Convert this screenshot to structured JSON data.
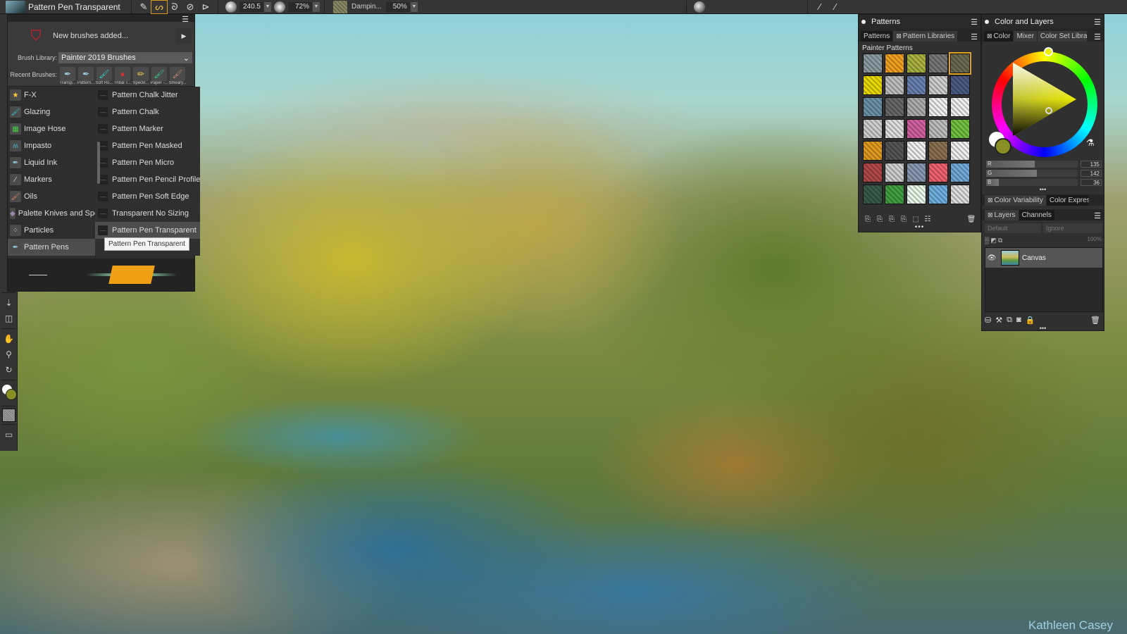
{
  "topbar": {
    "brush_category": "Pattern Pens",
    "brush_name": "Pattern Pen Transparent",
    "size_value": "240.5",
    "opacity_value": "72%",
    "damping_label": "Dampin...",
    "damping_value": "50%"
  },
  "brush_panel": {
    "new_brushes_label": "New brushes added...",
    "library_label": "Brush Library:",
    "library_value": "Painter 2019 Brushes",
    "recent_label": "Recent Brushes:",
    "recent": [
      {
        "label": "Transp..."
      },
      {
        "label": "Pattern..."
      },
      {
        "label": "Soft Ro..."
      },
      {
        "label": "Tribal T..."
      },
      {
        "label": "Speckl..."
      },
      {
        "label": "Paper -..."
      },
      {
        "label": "Smeary..."
      }
    ],
    "categories": [
      {
        "label": "F-X",
        "icon": "star-icon"
      },
      {
        "label": "Glazing",
        "icon": "glazing-brush-icon"
      },
      {
        "label": "Image Hose",
        "icon": "image-hose-icon"
      },
      {
        "label": "Impasto",
        "icon": "impasto-icon"
      },
      {
        "label": "Liquid Ink",
        "icon": "liquid-ink-icon"
      },
      {
        "label": "Markers",
        "icon": "marker-icon"
      },
      {
        "label": "Oils",
        "icon": "oil-brush-icon"
      },
      {
        "label": "Palette Knives and Sponges",
        "icon": "palette-knife-icon"
      },
      {
        "label": "Particles",
        "icon": "particles-icon"
      },
      {
        "label": "Pattern Pens",
        "icon": "pattern-pen-icon",
        "selected": true
      }
    ],
    "variants": [
      {
        "label": "Pattern Chalk Jitter"
      },
      {
        "label": "Pattern Chalk"
      },
      {
        "label": "Pattern Marker"
      },
      {
        "label": "Pattern Pen Masked"
      },
      {
        "label": "Pattern Pen Micro"
      },
      {
        "label": "Pattern Pen Pencil Profile"
      },
      {
        "label": "Pattern Pen Soft Edge"
      },
      {
        "label": "Transparent No Sizing"
      },
      {
        "label": "Pattern Pen Transparent",
        "selected": true
      }
    ],
    "tooltip": "Pattern Pen Transparent"
  },
  "patterns_panel": {
    "title": "Patterns",
    "tabs": [
      "Patterns",
      "Pattern Libraries"
    ],
    "library_name": "Painter Patterns",
    "swatches": [
      "#8a9aa0",
      "#f0a020",
      "#a8b040",
      "#777",
      "#6a6a50",
      "#e8d800",
      "#bbb",
      "#6a80b0",
      "#ccc",
      "#4a5a80",
      "#6a90a8",
      "#666",
      "#aaa",
      "#eee",
      "#eee",
      "#ccc",
      "#ddd",
      "#d060a0",
      "#bbb",
      "#70c040",
      "#e09a20",
      "#555",
      "#eee",
      "#8a7050",
      "#eee",
      "#b04848",
      "#ccc",
      "#8898b0",
      "#f06070",
      "#70a8d8",
      "#3a5a4a",
      "#40a040",
      "#e8f8e8",
      "#70b0e0",
      "#ddd"
    ],
    "selected_index": 4
  },
  "color_panel": {
    "title": "Color and Layers",
    "tabs": [
      "Color",
      "Mixer",
      "Color Set Libraries"
    ],
    "main_color": "#878e24",
    "secondary_color": "#ffffff",
    "rgb": {
      "r": 135,
      "g": 142,
      "b": 36
    },
    "sub_tabs": [
      "Color Variability",
      "Color Express"
    ],
    "layers_tabs": [
      "Layers",
      "Channels"
    ],
    "composite_method": "Default",
    "preserve": "Ignore",
    "opacity": "100%",
    "layers": [
      {
        "name": "Canvas",
        "visible": true
      }
    ]
  },
  "canvas": {
    "signature": "Kathleen Casey"
  }
}
